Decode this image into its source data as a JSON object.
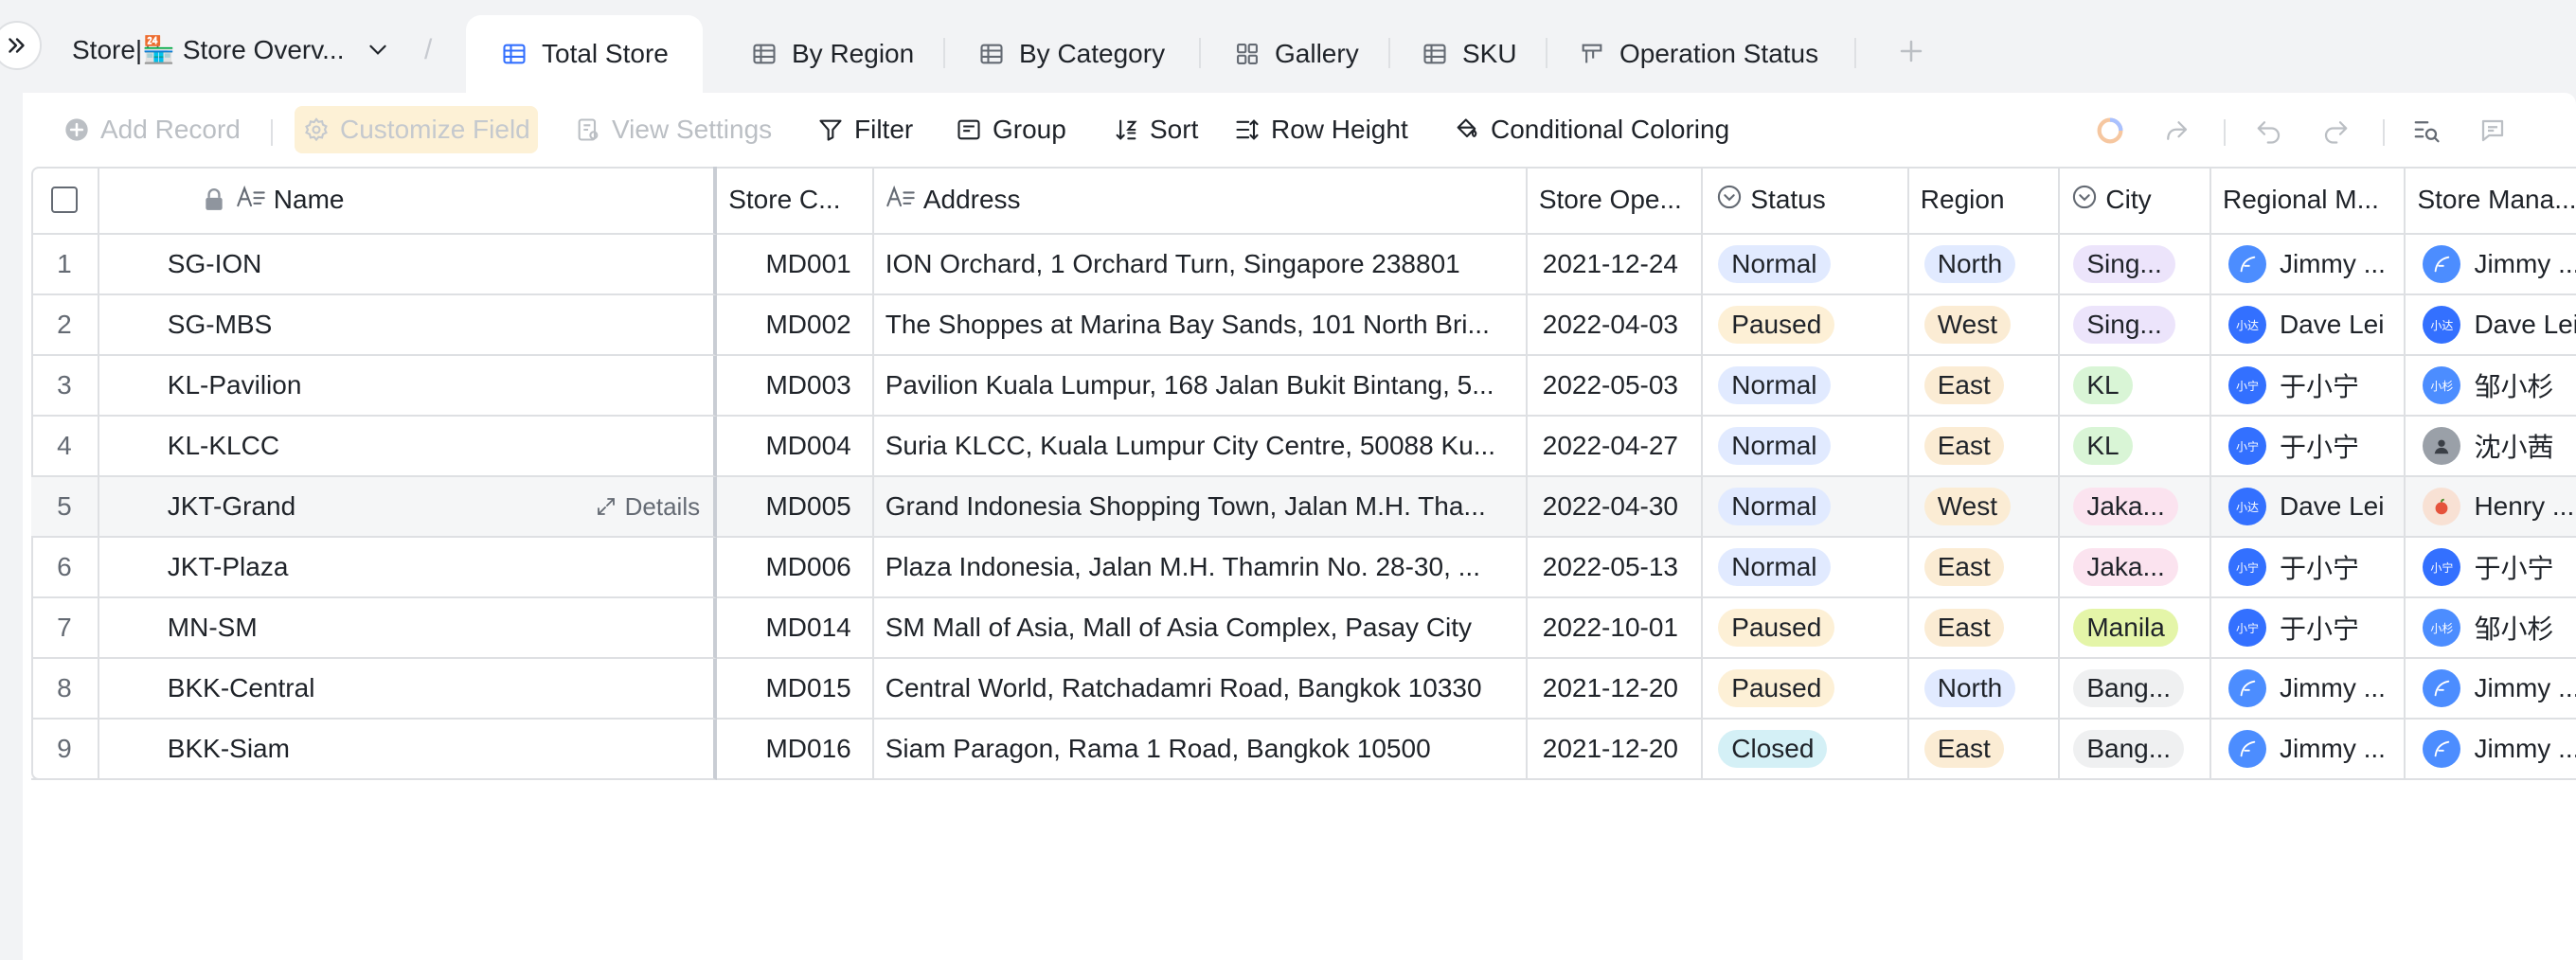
{
  "header": {
    "base_name": "Store|🏪 Store Overv...",
    "tabs": [
      {
        "label": "Total Store",
        "icon": "grid-table-icon"
      },
      {
        "label": "By Region",
        "icon": "grid-table-icon"
      },
      {
        "label": "By Category",
        "icon": "grid-table-icon"
      },
      {
        "label": "Gallery",
        "icon": "gallery-icon"
      },
      {
        "label": "SKU",
        "icon": "grid-table-icon"
      },
      {
        "label": "Operation Status",
        "icon": "kanban-icon"
      }
    ]
  },
  "toolbar": {
    "add_record": "Add Record",
    "customize_field": "Customize Field",
    "view_settings": "View Settings",
    "filter": "Filter",
    "group": "Group",
    "sort": "Sort",
    "row_height": "Row Height",
    "conditional_coloring": "Conditional Coloring"
  },
  "table": {
    "columns": {
      "name": "Name",
      "store_code": "Store C...",
      "address": "Address",
      "open_date": "Store Ope...",
      "status": "Status",
      "region": "Region",
      "city": "City",
      "regional_manager": "Regional M...",
      "store_manager": "Store Mana..."
    },
    "details_label": "Details",
    "rows": [
      {
        "num": "1",
        "name": "SG-ION",
        "code": "MD001",
        "address": "ION Orchard, 1 Orchard Turn, Singapore 238801",
        "date": "2021-12-24",
        "status": "Normal",
        "region": "North",
        "city": "Sing...",
        "rm": "Jimmy ...",
        "sm": "Jimmy ..."
      },
      {
        "num": "2",
        "name": "SG-MBS",
        "code": "MD002",
        "address": "The Shoppes at Marina Bay Sands, 101 North Bri...",
        "date": "2022-04-03",
        "status": "Paused",
        "region": "West",
        "city": "Sing...",
        "rm": "Dave Lei",
        "sm": "Dave Lei"
      },
      {
        "num": "3",
        "name": "KL-Pavilion",
        "code": "MD003",
        "address": "Pavilion Kuala Lumpur, 168 Jalan Bukit Bintang, 5...",
        "date": "2022-05-03",
        "status": "Normal",
        "region": "East",
        "city": "KL",
        "rm": "于小宁",
        "sm": "邹小杉"
      },
      {
        "num": "4",
        "name": "KL-KLCC",
        "code": "MD004",
        "address": "Suria KLCC, Kuala Lumpur City Centre, 50088 Ku...",
        "date": "2022-04-27",
        "status": "Normal",
        "region": "East",
        "city": "KL",
        "rm": "于小宁",
        "sm": "沈小茜"
      },
      {
        "num": "5",
        "name": "JKT-Grand",
        "code": "MD005",
        "address": "Grand Indonesia Shopping Town, Jalan M.H. Tha...",
        "date": "2022-04-30",
        "status": "Normal",
        "region": "West",
        "city": "Jaka...",
        "rm": "Dave Lei",
        "sm": "Henry ..."
      },
      {
        "num": "6",
        "name": "JKT-Plaza",
        "code": "MD006",
        "address": "Plaza Indonesia, Jalan M.H. Thamrin No. 28-30, ...",
        "date": "2022-05-13",
        "status": "Normal",
        "region": "East",
        "city": "Jaka...",
        "rm": "于小宁",
        "sm": "于小宁"
      },
      {
        "num": "7",
        "name": "MN-SM",
        "code": "MD014",
        "address": "SM Mall of Asia, Mall of Asia Complex, Pasay City",
        "date": "2022-10-01",
        "status": "Paused",
        "region": "East",
        "city": "Manila",
        "rm": "于小宁",
        "sm": "邹小杉"
      },
      {
        "num": "8",
        "name": "BKK-Central",
        "code": "MD015",
        "address": "Central World, Ratchadamri Road, Bangkok 10330",
        "date": "2021-12-20",
        "status": "Paused",
        "region": "North",
        "city": "Bang...",
        "rm": "Jimmy ...",
        "sm": "Jimmy ..."
      },
      {
        "num": "9",
        "name": "BKK-Siam",
        "code": "MD016",
        "address": "Siam Paragon, Rama 1 Road, Bangkok 10500",
        "date": "2021-12-20",
        "status": "Closed",
        "region": "East",
        "city": "Bang...",
        "rm": "Jimmy ...",
        "sm": "Jimmy ..."
      }
    ]
  },
  "avatars": {
    "dave_lei": "小达",
    "yu_xiaoning": "小宁",
    "zou_xiaoshan": "小杉"
  },
  "colors": {
    "accent": "#3370ff",
    "status_normal": "#e1eaff",
    "status_paused": "#fdf0d6",
    "status_closed": "#d4f0f6"
  }
}
